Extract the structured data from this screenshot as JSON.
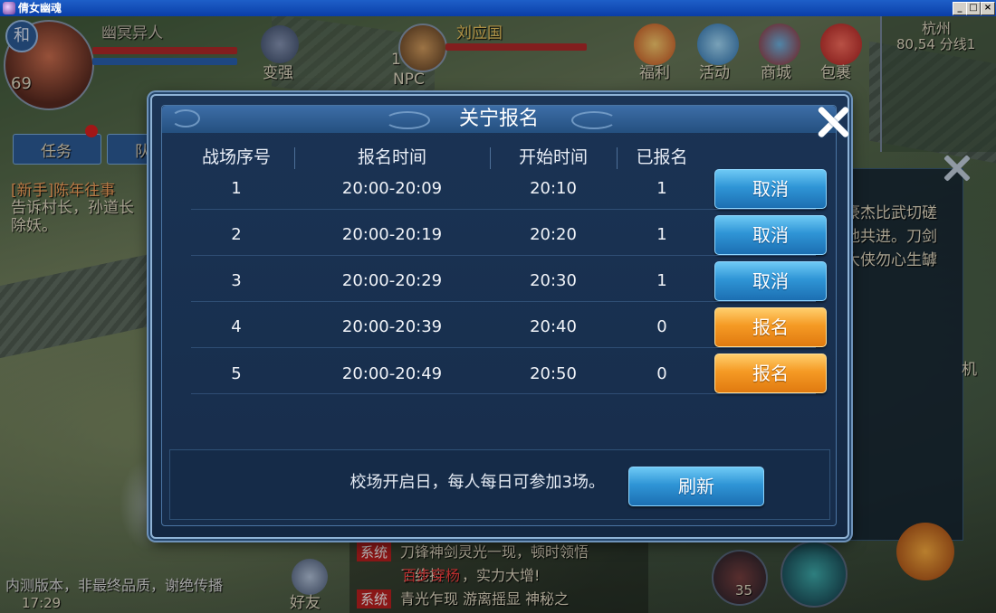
{
  "window": {
    "title": "倩女幽魂",
    "buttons": [
      "_",
      "□",
      "×"
    ]
  },
  "hud": {
    "player_badge": "和",
    "player_name": "幽冥异人",
    "player_level": "69",
    "target_name": "刘应国",
    "target_level": "1",
    "target_type": "NPC",
    "menu": [
      "变强",
      "福利",
      "活动",
      "商城",
      "包裹"
    ],
    "map_name": "杭州",
    "map_coords": "80,54 分线1",
    "quest_tabs": [
      "任务",
      "队"
    ],
    "quest_title": "[新手]陈年往事",
    "quest_desc": "告诉村长，孙道长\n除妖。",
    "right_panel_text": "豪杰比武切磋\n地共进。刀剑\n大侠勿心生罅",
    "right_side_label": "机",
    "chat_lines": [
      {
        "tag": "系统",
        "text": "刀锋神剑灵光一现，顿时领悟\n了绝技",
        "highlight": "百步穿杨",
        "suffix": "，实力大增!"
      },
      {
        "tag": "系统",
        "text": "青光乍现   游离摇显   神秘之"
      }
    ],
    "watermark": "内测版本，非最终品质，谢绝传播",
    "clock": "17:29",
    "friends_label": "好友",
    "skill_count": "35"
  },
  "dialog": {
    "title": "关宁报名",
    "columns": [
      "战场序号",
      "报名时间",
      "开始时间",
      "已报名"
    ],
    "rows": [
      {
        "index": "1",
        "signup_time": "20:00-20:09",
        "start_time": "20:10",
        "registered": "1",
        "action": "取消",
        "action_type": "cancel"
      },
      {
        "index": "2",
        "signup_time": "20:00-20:19",
        "start_time": "20:20",
        "registered": "1",
        "action": "取消",
        "action_type": "cancel"
      },
      {
        "index": "3",
        "signup_time": "20:00-20:29",
        "start_time": "20:30",
        "registered": "1",
        "action": "取消",
        "action_type": "cancel"
      },
      {
        "index": "4",
        "signup_time": "20:00-20:39",
        "start_time": "20:40",
        "registered": "0",
        "action": "报名",
        "action_type": "signup"
      },
      {
        "index": "5",
        "signup_time": "20:00-20:49",
        "start_time": "20:50",
        "registered": "0",
        "action": "报名",
        "action_type": "signup"
      }
    ],
    "footer_text": "校场开启日，每人每日可参加3场。",
    "refresh_label": "刷新"
  },
  "colors": {
    "cancel_button": "#2f95d6",
    "signup_button": "#f59a24",
    "dialog_bg": "#172d4b"
  }
}
